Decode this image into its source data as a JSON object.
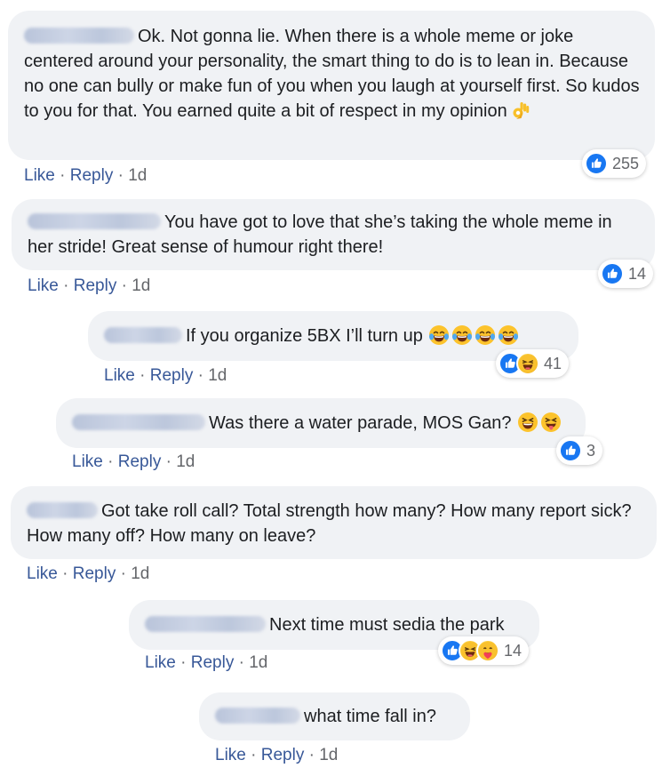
{
  "comments": [
    {
      "text": "Ok. Not gonna lie. When there is a whole meme or joke centered around your personality, the smart thing to do is to lean in. Because no one can bully or make fun of you when you laugh at yourself first. So kudos to you for that. You earned quite a bit of respect in my opinion",
      "like": "Like",
      "reply": "Reply",
      "time": "1d",
      "reaction_count": "255",
      "reactions": [
        "like-icon"
      ],
      "trailing_emoji": [
        "ok-hand-icon"
      ]
    },
    {
      "text": "You have got to love that she’s taking the whole meme in her stride! Great sense of humour right there!",
      "like": "Like",
      "reply": "Reply",
      "time": "1d",
      "reaction_count": "14",
      "reactions": [
        "like-icon"
      ]
    },
    {
      "text": "If you organize 5BX I’ll turn up",
      "like": "Like",
      "reply": "Reply",
      "time": "1d",
      "reaction_count": "41",
      "reactions": [
        "like-icon",
        "haha-icon"
      ],
      "trailing_emoji": [
        "tears-of-joy-icon",
        "tears-of-joy-icon",
        "tears-of-joy-icon",
        "tears-of-joy-icon"
      ]
    },
    {
      "text": "Was there a water parade, MOS Gan?",
      "like": "Like",
      "reply": "Reply",
      "time": "1d",
      "reaction_count": "3",
      "reactions": [
        "like-icon"
      ],
      "trailing_emoji": [
        "grinning-squint-icon",
        "squinting-tongue-icon"
      ]
    },
    {
      "text": "Got take roll call? Total strength how many? How many report sick? How many off? How many on leave?",
      "like": "Like",
      "reply": "Reply",
      "time": "1d"
    },
    {
      "text": "Next time must sedia the park",
      "like": "Like",
      "reply": "Reply",
      "time": "1d",
      "reaction_count": "14",
      "reactions": [
        "like-icon",
        "haha-icon",
        "care-icon"
      ]
    },
    {
      "text": "what time fall in?",
      "like": "Like",
      "reply": "Reply",
      "time": "1d"
    }
  ],
  "colors": {
    "bubble": "#f0f2f5",
    "link": "#385898",
    "muted": "#65676b",
    "like_blue": "#1877f2"
  }
}
